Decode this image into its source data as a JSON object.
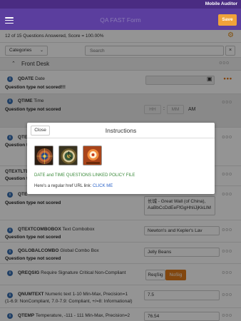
{
  "status_bar": {
    "app_name": "Mobile Auditor"
  },
  "header": {
    "title": "QA FAST Form",
    "save_label": "Save"
  },
  "summary": {
    "text": "12 of 15 Questions Answered, Score = 100.00%"
  },
  "filter": {
    "categories_label": "Categories",
    "search_placeholder": "Search",
    "clear_label": "×"
  },
  "section": {
    "label": "Front Desk",
    "dots": "ooo"
  },
  "questions": [
    {
      "code": "QDATE",
      "text": "Date",
      "sub": "Question type not scored!!!"
    },
    {
      "code": "QTIME",
      "text": "Time",
      "sub": "Question type not scored",
      "hh": "HH",
      "mm": "MM",
      "ampm": "AM"
    },
    {
      "code": "QTE",
      "sub": "Question type not"
    },
    {
      "code": "QTEXTLTD",
      "sub": "Question type not"
    },
    {
      "code": "QTE",
      "sub": "Question type not scored",
      "value_line1": "长城 - Great Wall (of China),",
      "value_line2": "AaBbCcDdEeFfGgHhIiJjKkLlM"
    },
    {
      "code": "QTEXTCOMBOBOX",
      "text": "Text Combobox",
      "sub": "Question type not scored",
      "value": "Newton's and Kepler's Lav"
    },
    {
      "code": "QGLOBALCOMBO",
      "text": "Global Combo Box",
      "sub": "Question type not scored",
      "value": "Jelly Beans"
    },
    {
      "code": "QREQSIG",
      "text": "Require Signature Critical Non-Compliant",
      "opt1": "ReqSig",
      "opt2": "NoSig"
    },
    {
      "code": "QNUMTEXT",
      "text": "Numeric text 1-10 Min-Max, Precision=1",
      "text2": "(1-6.9: NonCompliant, 7.0-7.9: Compliant, +/=8: Informational)",
      "value": "7.5"
    },
    {
      "code": "QTEMP",
      "text": "Temperature, -111 - 111 Min-Max, Precision=2",
      "value": "76.54"
    }
  ],
  "modal": {
    "close_label": "Close",
    "title": "Instructions",
    "link_file": "DATE and TIME QUESTIONS LINKED POLICY FILE",
    "href_text": "Here's a regular href URL link:",
    "href_link": "CLICK ME"
  },
  "colors": {
    "header": "#5b3e9e",
    "status_bar": "#4a2c82",
    "accent": "#f0a23a",
    "info": "#3a6fb0"
  }
}
